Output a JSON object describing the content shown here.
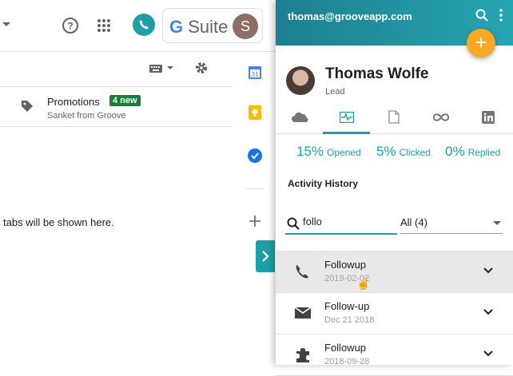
{
  "gmail": {
    "gsuite_g": "G",
    "gsuite_label": "Suite",
    "avatar_letter": "S",
    "promotions_label": "Promotions",
    "promotions_badge": "4 new",
    "promotions_sender": "Sanket from Groove",
    "tabs_message": "tabs will be shown here."
  },
  "groove": {
    "account_email": "thomas@grooveapp.com",
    "fab_label": "+",
    "contact": {
      "name": "Thomas Wolfe",
      "status": "Lead"
    },
    "tabs": [
      {
        "icon": "salesforce-cloud-icon",
        "active": false
      },
      {
        "icon": "activity-pulse-icon",
        "active": true
      },
      {
        "icon": "document-icon",
        "active": false
      },
      {
        "icon": "infinity-icon",
        "active": false
      },
      {
        "icon": "linkedin-icon",
        "active": false
      }
    ],
    "stats": {
      "opened_value": "15%",
      "opened_label": "Opened",
      "clicked_value": "5%",
      "clicked_label": "Clicked",
      "replied_value": "0%",
      "replied_label": "Replied"
    },
    "activity_title": "Activity History",
    "search_value": "follo",
    "filter_value": "All (4)",
    "activities": [
      {
        "icon": "phone-icon",
        "title": "Followup",
        "date": "2019-02-02"
      },
      {
        "icon": "email-icon",
        "title": "Follow-up",
        "date": "Dec 21 2018"
      },
      {
        "icon": "puzzle-icon",
        "title": "Followup",
        "date": "2018-09-28"
      }
    ]
  },
  "colors": {
    "accent": "#1e9fa8",
    "fab": "#f9a825",
    "badge": "#188038"
  }
}
